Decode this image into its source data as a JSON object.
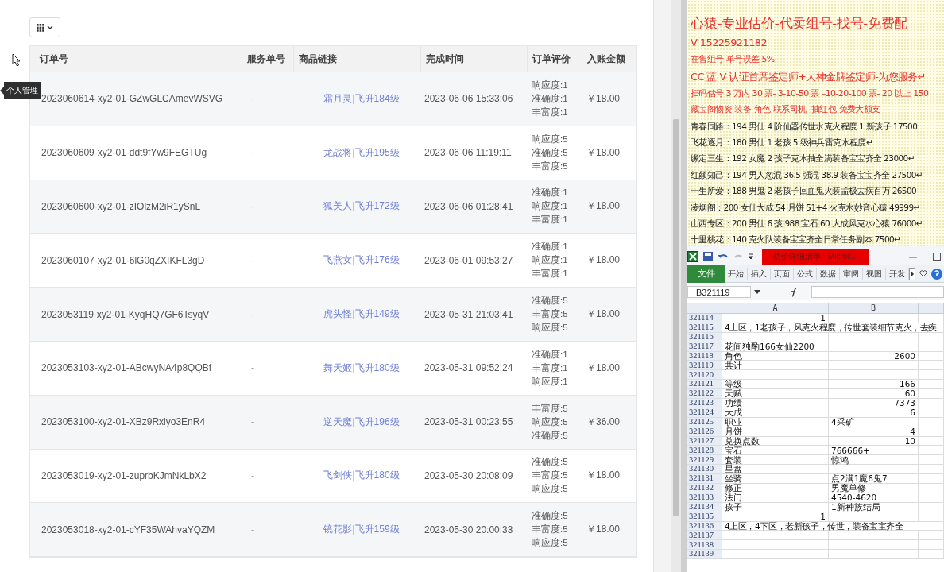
{
  "orders_panel": {
    "columns": [
      "订单号",
      "服务单号",
      "商品链接",
      "完成时间",
      "订单评价",
      "入账金额"
    ],
    "rows": [
      {
        "order_no": "2023060614-xy2-01-GZwGLCAmevWSVG",
        "service_no": "-",
        "product_link": "霜月灵|飞升184级",
        "completed_at": "2023-06-06 15:33:06",
        "ratings": [
          "响应度:1",
          "准确度:1",
          "丰富度:1"
        ],
        "amount": "￥18.00"
      },
      {
        "order_no": "2023060609-xy2-01-ddt9fYw9FEGTUg",
        "service_no": "-",
        "product_link": "龙战将|飞升195级",
        "completed_at": "2023-06-06 11:19:11",
        "ratings": [
          "响应度:5",
          "准确度:5",
          "丰富度:5"
        ],
        "amount": "￥18.00"
      },
      {
        "order_no": "2023060600-xy2-01-zIOlzM2iR1ySnL",
        "service_no": "-",
        "product_link": "狐美人|飞升172级",
        "completed_at": "2023-06-06 01:28:41",
        "ratings": [
          "准确度:1",
          "响应度:1",
          "丰富度:1"
        ],
        "amount": "￥18.00"
      },
      {
        "order_no": "2023060107-xy2-01-6lG0qZXIKFL3gD",
        "service_no": "-",
        "product_link": "飞燕女|飞升176级",
        "completed_at": "2023-06-01 09:53:27",
        "ratings": [
          "准确度:1",
          "响应度:1",
          "丰富度:1"
        ],
        "amount": "￥18.00"
      },
      {
        "order_no": "2023053119-xy2-01-KyqHQ7GF6TsyqV",
        "service_no": "-",
        "product_link": "虎头怪|飞升149级",
        "completed_at": "2023-05-31 21:03:41",
        "ratings": [
          "准确度:5",
          "丰富度:5",
          "响应度:5"
        ],
        "amount": "￥18.00"
      },
      {
        "order_no": "2023053103-xy2-01-ABcwyNA4p8QQBf",
        "service_no": "-",
        "product_link": "舞天姬|飞升180级",
        "completed_at": "2023-05-31 09:52:24",
        "ratings": [
          "准确度:1",
          "丰富度:1",
          "响应度:1"
        ],
        "amount": "￥18.00"
      },
      {
        "order_no": "2023053100-xy2-01-XBz9Rxiyo3EnR4",
        "service_no": "-",
        "product_link": "逆天魔|飞升196级",
        "completed_at": "2023-05-31 00:23:55",
        "ratings": [
          "丰富度:5",
          "响应度:5",
          "准确度:5"
        ],
        "amount": "￥36.00"
      },
      {
        "order_no": "2023053019-xy2-01-zuprbKJmNkLbX2",
        "service_no": "-",
        "product_link": "飞剑侠|飞升180级",
        "completed_at": "2023-05-30 20:08:09",
        "ratings": [
          "准确度:5",
          "丰富度:5",
          "响应度:5"
        ],
        "amount": "￥18.00"
      },
      {
        "order_no": "2023053018-xy2-01-cYF35WAhvaYQZM",
        "service_no": "-",
        "product_link": "镜花影|飞升159级",
        "completed_at": "2023-05-30 20:00:33",
        "ratings": [
          "准确度:5",
          "丰富度:5",
          "响应度:5"
        ],
        "amount": "￥18.00"
      }
    ]
  },
  "tooltip": "个人管理",
  "ad_document": {
    "title": "心猿-专业估价-代卖组号-找号-免费配",
    "red_lines": [
      "V 15225921182",
      "在售组号-单号误差 5%",
      "CC 蓝 V 认证首席鉴定师+大神金牌鉴定师-为您服务↵",
      "扫码估号 3 万内 30 票- 3-10-50 票  –10-20-100 票- 20 以上 150",
      "藏宝阁物资-装备-角色-联系司机--抽红包-免费大额支"
    ],
    "listings": [
      "青春同路：194 男仙 4 阶仙器传世水克火程度 1 新孩子 17500",
      "飞花逐月：180 男仙 1 老孩 5 级神兵雷克水程度↵",
      "缘定三生：192 女魔 2 孩子克水抽全满装备宝宝齐全 23000↵",
      "红颜知己：194 男人忽混 36.5 强混 38.9 装备宝宝齐全 27500↵",
      "一生所爱：188 男鬼 2 老孩子回血鬼火装孟极去疾百万 26500",
      "凌烟阁：200 女仙大成 54 月饼 51+4 火克水妙音心猿 49999↵",
      "山西专区：200 男仙 6 孩 988 宝石 60 大成风克水心猿 76000↵",
      "十里桃花：140 克火队装备宝宝齐全日常任务副本 7500↵"
    ]
  },
  "spreadsheet": {
    "title": "估价详细清单 - Micros...",
    "file_tab": "文件",
    "ribbon_tabs": [
      "开始",
      "插入",
      "页面",
      "公式",
      "数据",
      "审阅",
      "视图",
      "开发"
    ],
    "name_box": "B321119",
    "columns": [
      "A",
      "B"
    ],
    "rows": [
      {
        "num": "321114",
        "kind": "count",
        "a": "1"
      },
      {
        "num": "321115",
        "kind": "note",
        "a": "4上区，1老孩子，风克火程度，传世套装细节克火，去疾"
      },
      {
        "num": "321116",
        "kind": "blank"
      },
      {
        "num": "321117",
        "kind": "text",
        "a": "花间独酌166女仙2200"
      },
      {
        "num": "321118",
        "kind": "number",
        "a": "角色",
        "b": "2600"
      },
      {
        "num": "321119",
        "kind": "text",
        "a": "共计"
      },
      {
        "num": "321120",
        "kind": "blank"
      },
      {
        "num": "321121",
        "kind": "number",
        "a": "等级",
        "b": "166"
      },
      {
        "num": "321122",
        "kind": "number",
        "a": "天赋",
        "b": "60"
      },
      {
        "num": "321123",
        "kind": "number",
        "a": "功绩",
        "b": "7373"
      },
      {
        "num": "321124",
        "kind": "number",
        "a": "大成",
        "b": "6"
      },
      {
        "num": "321125",
        "kind": "text",
        "a": "职业",
        "b": "4采矿"
      },
      {
        "num": "321126",
        "kind": "number",
        "a": "月饼",
        "b": "4"
      },
      {
        "num": "321127",
        "kind": "number",
        "a": "兑换点数",
        "b": "10"
      },
      {
        "num": "321128",
        "kind": "text",
        "a": "宝石",
        "b": "766666+"
      },
      {
        "num": "321129",
        "kind": "text",
        "a": "套装",
        "b": "惊鸿"
      },
      {
        "num": "321130",
        "kind": "text",
        "a": "星盘"
      },
      {
        "num": "321131",
        "kind": "text",
        "a": "坐骑",
        "b": "点2满1魔6鬼7"
      },
      {
        "num": "321132",
        "kind": "text",
        "a": "修正",
        "b": "男魔单修"
      },
      {
        "num": "321133",
        "kind": "text",
        "a": "法门",
        "b": "4540-4620"
      },
      {
        "num": "321134",
        "kind": "text",
        "a": "孩子",
        "b": "1新种族结局"
      },
      {
        "num": "321135",
        "kind": "count",
        "a": "1"
      },
      {
        "num": "321136",
        "kind": "note",
        "a": "4上区，4下区，老新孩子，传世，装备宝宝齐全"
      },
      {
        "num": "321137",
        "kind": "blank"
      },
      {
        "num": "321138",
        "kind": "blank"
      },
      {
        "num": "321139",
        "kind": "blank"
      }
    ]
  }
}
